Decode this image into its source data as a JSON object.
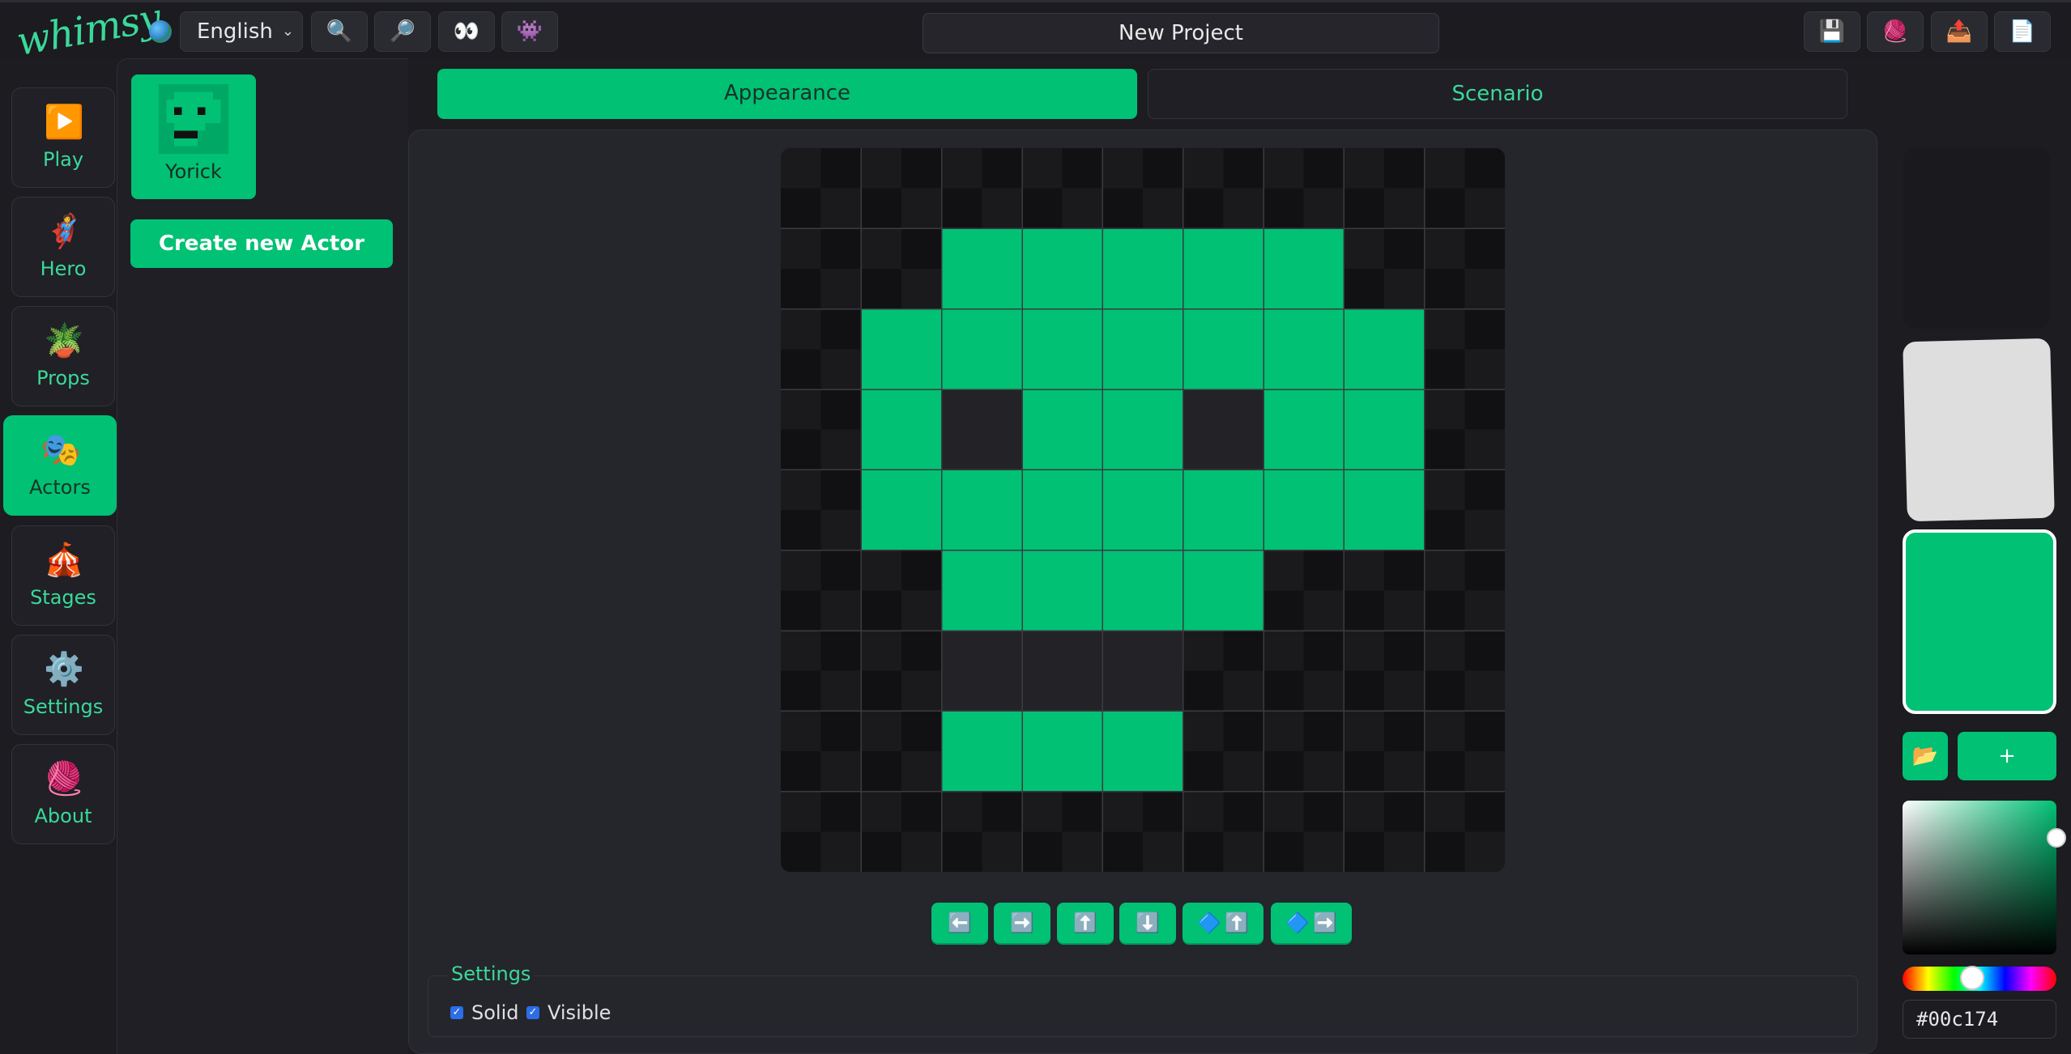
{
  "app": {
    "logo_text": "whimsy"
  },
  "topbar": {
    "language": "English",
    "project_title": "New Project",
    "buttons": [
      {
        "icon": "zoom-in-icon",
        "glyph": "🔍"
      },
      {
        "icon": "zoom-out-icon",
        "glyph": "🔎"
      },
      {
        "icon": "eye-icon",
        "glyph": "👀"
      },
      {
        "icon": "alien-monster-icon",
        "glyph": "👾"
      }
    ],
    "file_buttons": [
      {
        "icon": "save-icon",
        "glyph": "💾"
      },
      {
        "icon": "yarn-icon",
        "glyph": "🧶"
      },
      {
        "icon": "export-icon",
        "glyph": "📤"
      },
      {
        "icon": "document-icon",
        "glyph": "📄"
      }
    ]
  },
  "sidebar": {
    "items": [
      {
        "label": "Play",
        "icon": "play-icon",
        "glyph": "▶️"
      },
      {
        "label": "Hero",
        "icon": "hero-icon",
        "glyph": "🦸"
      },
      {
        "label": "Props",
        "icon": "plant-icon",
        "glyph": "🪴"
      },
      {
        "label": "Actors",
        "icon": "theater-masks-icon",
        "glyph": "🎭",
        "active": true
      },
      {
        "label": "Stages",
        "icon": "circus-tent-icon",
        "glyph": "🎪"
      },
      {
        "label": "Settings",
        "icon": "gear-icon",
        "glyph": "⚙️"
      },
      {
        "label": "About",
        "icon": "yarn-icon",
        "glyph": "🧶"
      }
    ]
  },
  "actors": {
    "list": [
      {
        "name": "Yorick"
      }
    ],
    "create_label": "Create new Actor"
  },
  "tabs": [
    {
      "label": "Appearance",
      "active": true
    },
    {
      "label": "Scenario",
      "active": false
    }
  ],
  "editor": {
    "grid_size": 9,
    "fill_color": "#00c174",
    "empty_color": "#232327",
    "filled_cells": [
      [
        1,
        2
      ],
      [
        1,
        3
      ],
      [
        1,
        4
      ],
      [
        1,
        5
      ],
      [
        1,
        6
      ],
      [
        2,
        1
      ],
      [
        2,
        2
      ],
      [
        2,
        3
      ],
      [
        2,
        4
      ],
      [
        2,
        5
      ],
      [
        2,
        6
      ],
      [
        2,
        7
      ],
      [
        3,
        1
      ],
      [
        3,
        3
      ],
      [
        3,
        4
      ],
      [
        3,
        6
      ],
      [
        3,
        7
      ],
      [
        4,
        1
      ],
      [
        4,
        2
      ],
      [
        4,
        3
      ],
      [
        4,
        4
      ],
      [
        4,
        5
      ],
      [
        4,
        6
      ],
      [
        4,
        7
      ],
      [
        5,
        2
      ],
      [
        5,
        3
      ],
      [
        5,
        4
      ],
      [
        5,
        5
      ],
      [
        7,
        2
      ],
      [
        7,
        3
      ],
      [
        7,
        4
      ]
    ],
    "dark_cells": [
      [
        3,
        2
      ],
      [
        3,
        5
      ],
      [
        6,
        2
      ],
      [
        6,
        3
      ],
      [
        6,
        4
      ]
    ],
    "tools": [
      {
        "name": "shift-left-button",
        "glyphs": [
          "⬅️"
        ]
      },
      {
        "name": "shift-right-button",
        "glyphs": [
          "➡️"
        ]
      },
      {
        "name": "shift-up-button",
        "glyphs": [
          "⬆️"
        ]
      },
      {
        "name": "shift-down-button",
        "glyphs": [
          "⬇️"
        ]
      },
      {
        "name": "flip-vertical-button",
        "glyphs": [
          "🔷",
          "⬆️"
        ]
      },
      {
        "name": "flip-horizontal-button",
        "glyphs": [
          "🔷",
          "➡️"
        ]
      }
    ]
  },
  "settings": {
    "legend": "Settings",
    "solid_label": "Solid",
    "solid_checked": true,
    "visible_label": "Visible",
    "visible_checked": true
  },
  "colors": {
    "swatches": [
      "#1a1a1e",
      "#dedede",
      "#00c174"
    ],
    "open_button_glyph": "📂",
    "add_button_label": "+",
    "hex_value": "#00c174"
  }
}
